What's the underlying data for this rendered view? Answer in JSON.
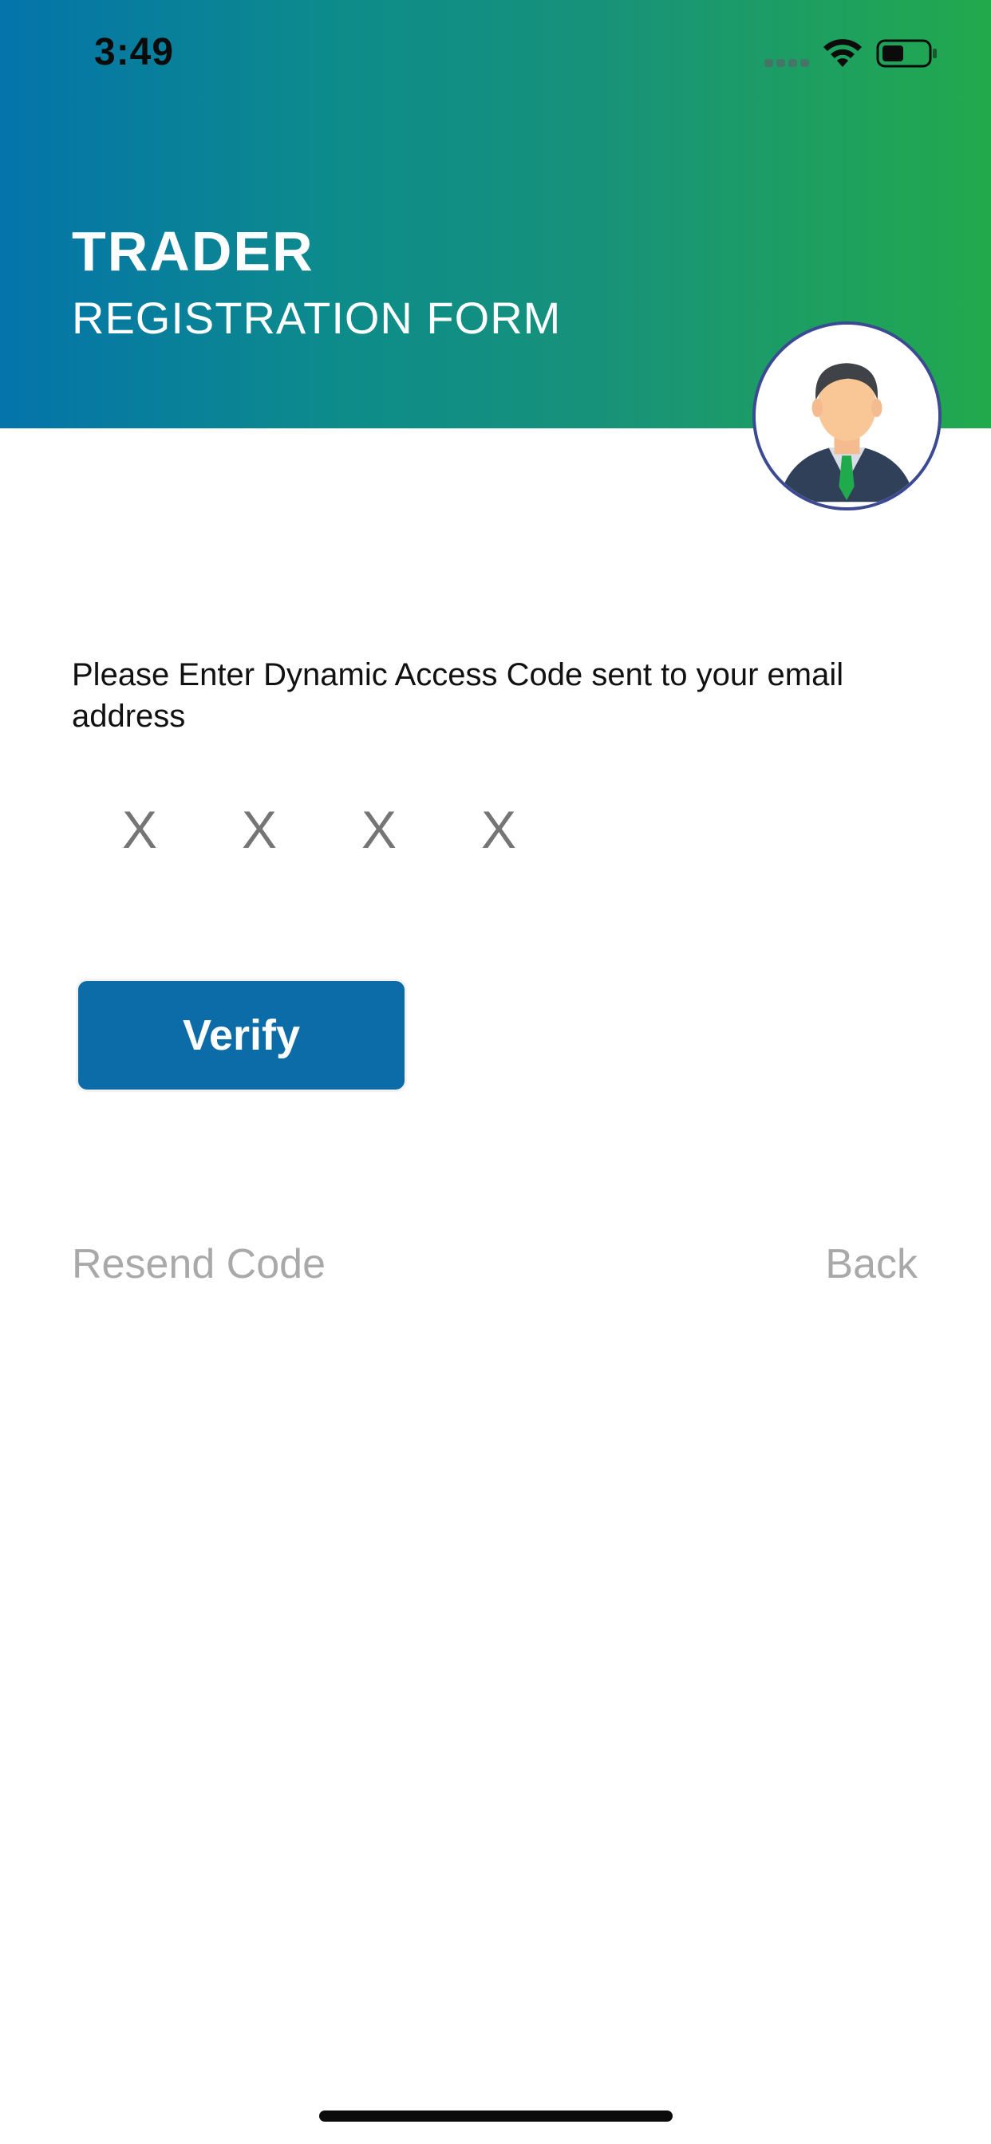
{
  "status_bar": {
    "time": "3:49"
  },
  "header": {
    "title": "TRADER",
    "subtitle": "REGISTRATION FORM",
    "gradient_start": "#0474aa",
    "gradient_end": "#22a94c"
  },
  "avatar": {
    "icon": "businessman-avatar-icon"
  },
  "form": {
    "instruction": "Please Enter Dynamic Access Code sent to your email address",
    "code_placeholders": [
      "X",
      "X",
      "X",
      "X"
    ],
    "verify_label": "Verify"
  },
  "footer_links": {
    "resend_label": "Resend Code",
    "back_label": "Back"
  },
  "colors": {
    "primary_button": "#0b6ca8",
    "muted_text": "#a9a9a9"
  }
}
